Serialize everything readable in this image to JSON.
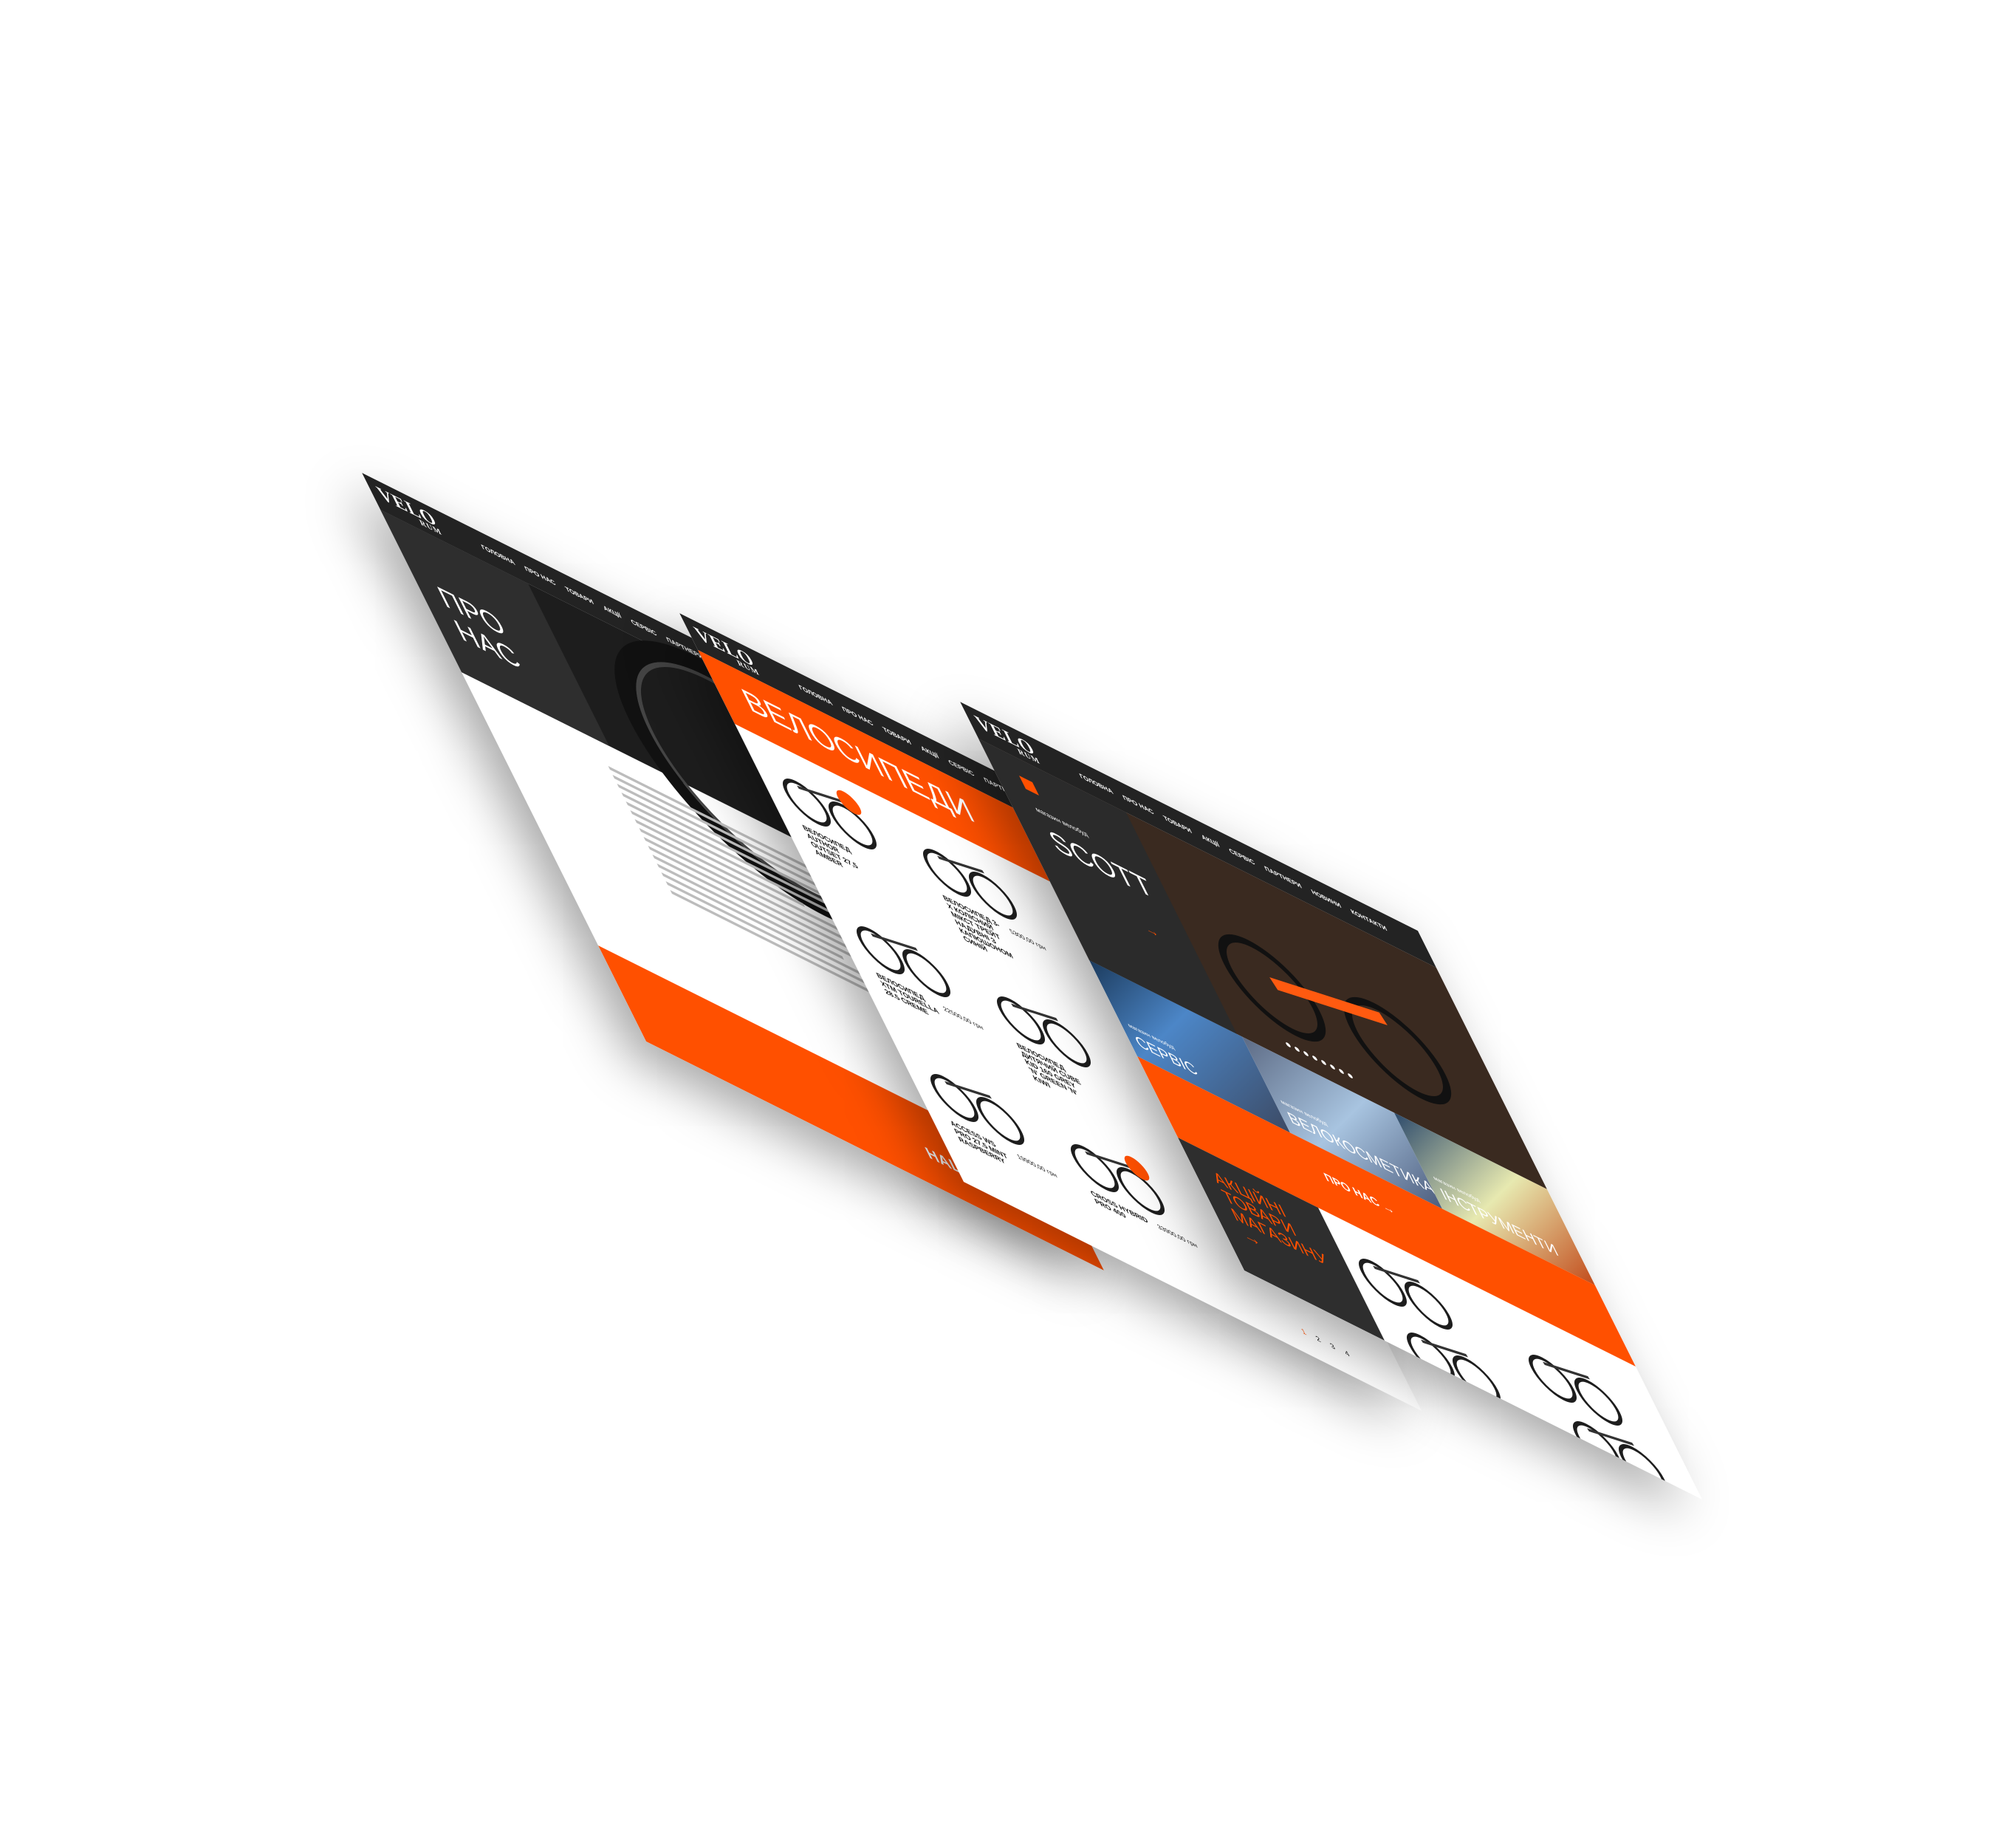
{
  "brand": {
    "logo_main": "VELO",
    "logo_sub": "RUM"
  },
  "nav": [
    "Головна",
    "Про нас",
    "Товари",
    "Акції",
    "Сервіс",
    "Партнери",
    "Новини",
    "Контакти"
  ],
  "colors": {
    "accent": "#ff5000",
    "dark": "#2e2e2e",
    "background": "#ffffff"
  },
  "about_page": {
    "title": "ПРО НАС",
    "footer_cta": "НАШІ КОНТАКТИ"
  },
  "catalog_page": {
    "title": "ВЕЛОСИПЕДИ",
    "products": [
      {
        "name": "ВЕЛОСИПЕД AUTHOR OUTSET 27,5 AMBER",
        "price": "",
        "badge": true
      },
      {
        "name": "ВЕЛОСИПЕД 3-Х КОЛІСНИЙ МІКСТ ТРЕЙТ НАДУВНІ З КАПЮШОНОМ СИНІЙ",
        "price": "5300,00 грн",
        "badge": false
      },
      {
        "name": "ВЕЛОСИПЕД XTM TOURELLA 28.5 CREME",
        "price": "22500,00 грн",
        "badge": false
      },
      {
        "name": "ВЕЛОСИПЕД ДИТЯЧИЙ CUBE KID 160 GREY 'N' GREEN 'N' KIWI",
        "price": "",
        "badge": false
      },
      {
        "name": "ACCESS WS PRO 27.5 MINT RASPBERRY",
        "price": "19900,00 грн",
        "badge": false
      },
      {
        "name": "CROSS HYBRID PRO 400",
        "price": "33900,00 грн",
        "badge": true
      }
    ],
    "pages": [
      "1",
      "2",
      "3",
      "4"
    ]
  },
  "home_page": {
    "hero_subtitle": "магазин велобуд",
    "hero_title": "SCOTT",
    "hero_arrow": "→",
    "tiles": [
      {
        "subtitle": "магазин велобуд",
        "title": "СЕРВІС"
      },
      {
        "subtitle": "магазин велобуд",
        "title": "ВЕЛОКОСМЕТИКА"
      },
      {
        "subtitle": "магазин велобуд",
        "title": "ІНСТРУМЕНТИ"
      }
    ],
    "cta": "ПРО НАС →",
    "promo": "АКЦІЙНІ ТОВАРИ МАГАЗИНУ →"
  }
}
